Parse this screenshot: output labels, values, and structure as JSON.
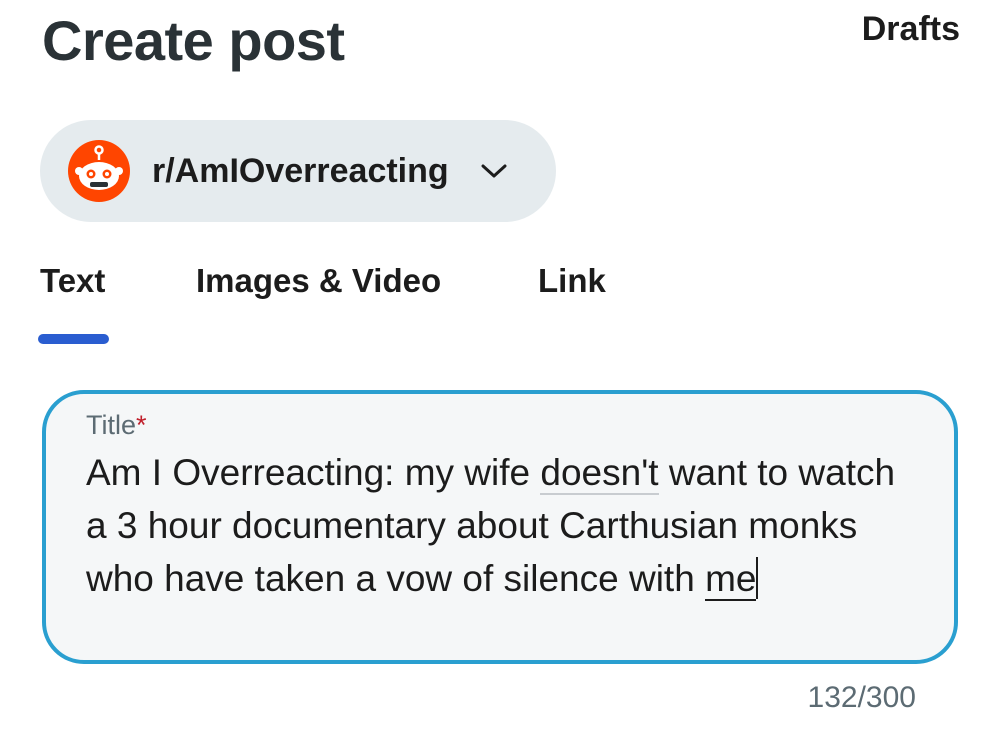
{
  "header": {
    "title": "Create post",
    "drafts_label": "Drafts"
  },
  "community": {
    "name": "r/AmIOverreacting",
    "avatar_icon": "reddit-snoo-icon",
    "dropdown_icon": "chevron-down-icon"
  },
  "tabs": [
    {
      "label": "Text",
      "active": true
    },
    {
      "label": "Images & Video",
      "active": false
    },
    {
      "label": "Link",
      "active": false
    }
  ],
  "title_field": {
    "label": "Title",
    "required_mark": "*",
    "value_parts": {
      "p1": "Am I Overreacting: my wife ",
      "p2": "doesn't",
      "p3": " want to watch a 3 hour documentary about Carthusian monks who have taken a vow of silence with ",
      "p4": "me"
    },
    "char_count": "132/300"
  },
  "colors": {
    "accent_tab": "#2a5dd0",
    "field_border": "#2a9fd0",
    "avatar": "#ff4500",
    "required": "#c0202c"
  }
}
